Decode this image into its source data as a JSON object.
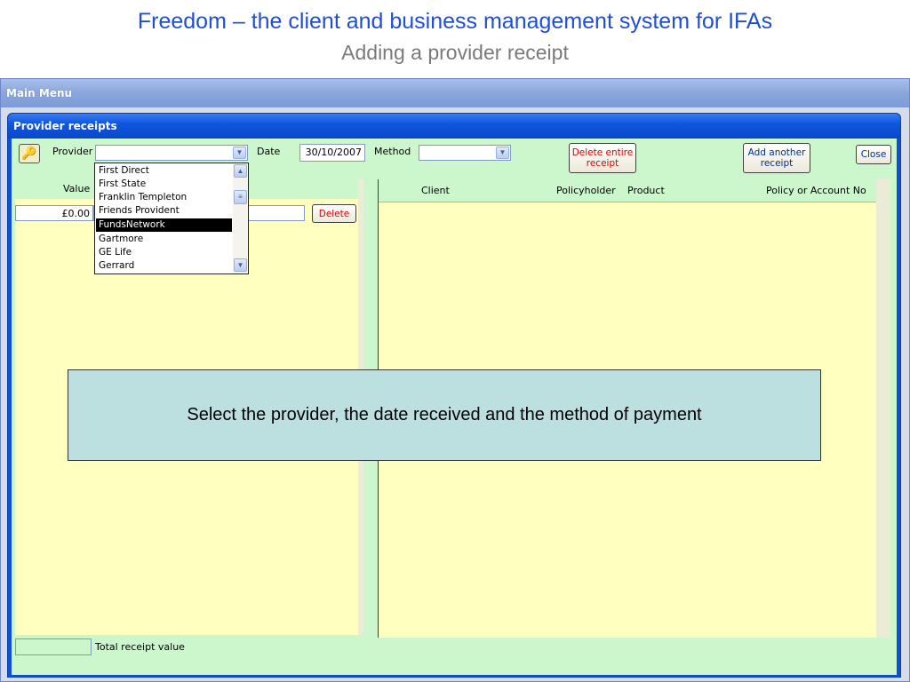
{
  "slide": {
    "title": "Freedom – the client and business management system for IFAs",
    "subtitle": "Adding a provider receipt"
  },
  "main_window": {
    "title": "Main Menu"
  },
  "receipts_window": {
    "title": "Provider receipts",
    "provider_label": "Provider",
    "provider_value": "",
    "date_label": "Date",
    "date_value": "30/10/2007",
    "method_label": "Method",
    "method_value": "",
    "delete_entire_label": "Delete entire receipt",
    "add_another_label": "Add another receipt",
    "close_label": "Close",
    "left_header": "Value",
    "value_field": "£0.00",
    "delete_label": "Delete",
    "total_label": "Total receipt value",
    "total_value": "",
    "columns": [
      "Client",
      "Policyholder",
      "Product",
      "Policy or Account No"
    ]
  },
  "provider_dropdown": {
    "options": [
      "First Direct",
      "First State",
      "Franklin Templeton",
      "Friends Provident",
      "FundsNetwork",
      "Gartmore",
      "GE Life",
      "Gerrard"
    ],
    "selected": "FundsNetwork"
  },
  "callout": {
    "text": "Select the provider, the date received and the method of payment"
  },
  "colors": {
    "form_bg": "#ccf7cc",
    "grid_bg": "#ffffc0",
    "title_blue": "#1f4fd6",
    "callout_bg": "#bcdfe0"
  }
}
